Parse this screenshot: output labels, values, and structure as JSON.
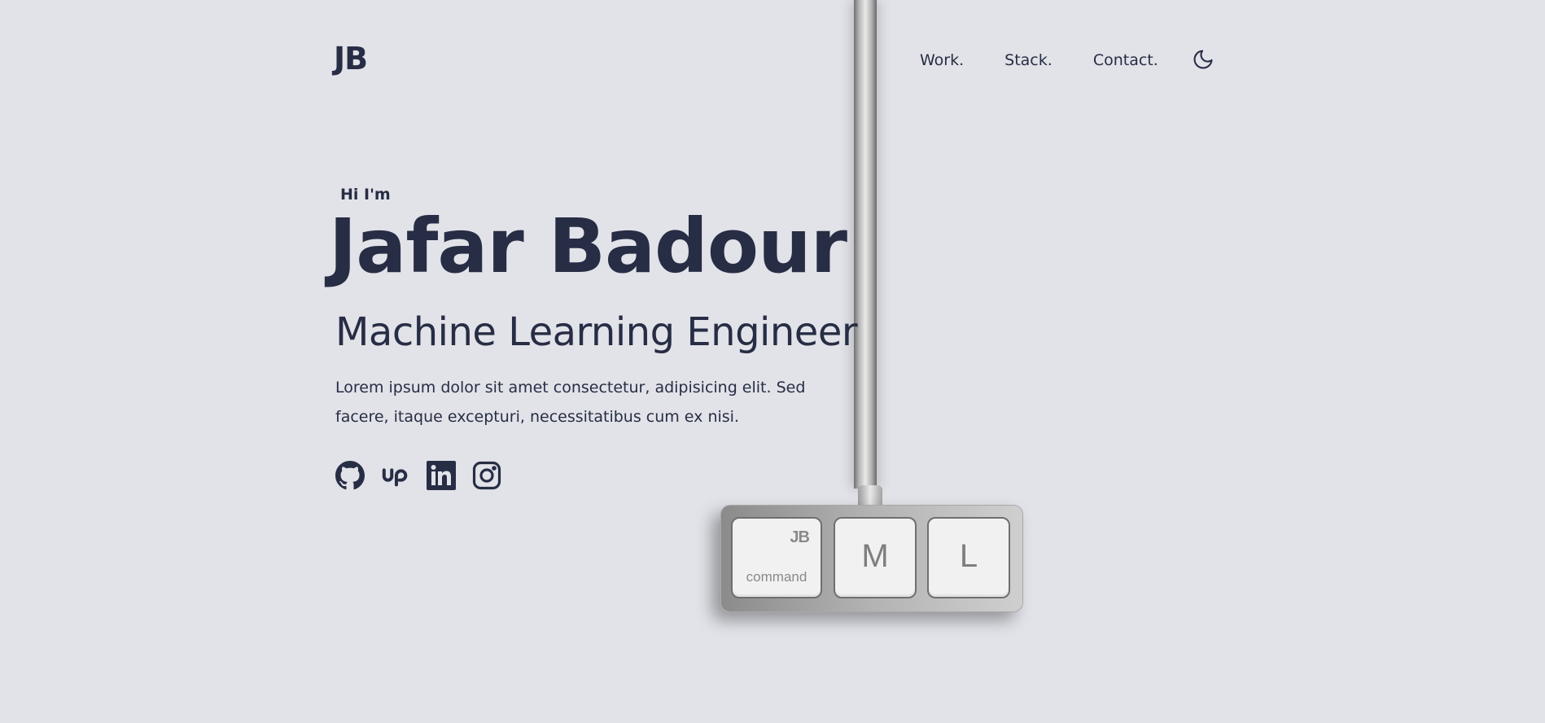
{
  "header": {
    "logo": "JB",
    "nav": [
      {
        "label": "Work."
      },
      {
        "label": "Stack."
      },
      {
        "label": "Contact."
      }
    ],
    "theme_toggle_icon": "moon-icon"
  },
  "hero": {
    "greeting": "Hi I'm",
    "name": "Jafar Badour",
    "role": "Machine Learning Engineer",
    "bio": "Lorem ipsum dolor sit amet consectetur, adipisicing elit. Sed facere, itaque excepturi, necessitatibus cum ex nisi.",
    "socials": [
      {
        "icon": "github-icon"
      },
      {
        "icon": "upwork-icon"
      },
      {
        "icon": "linkedin-icon"
      },
      {
        "icon": "instagram-icon"
      }
    ]
  },
  "keyboard": {
    "keys": [
      {
        "logo": "JB",
        "label": "command"
      },
      {
        "label": "M"
      },
      {
        "label": "L"
      }
    ]
  },
  "colors": {
    "background": "#e2e3e9",
    "text": "#272d44"
  }
}
